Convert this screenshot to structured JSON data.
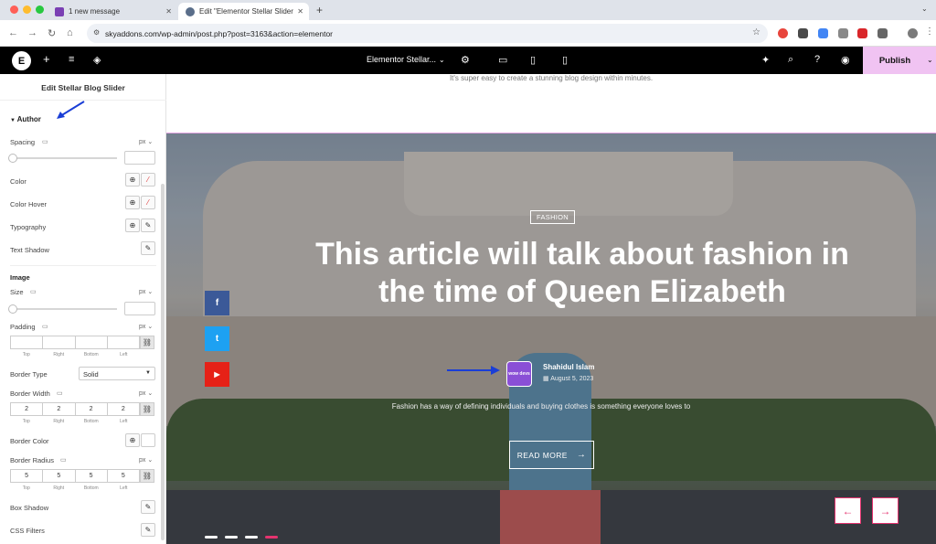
{
  "browser": {
    "tabs": [
      {
        "label": "1 new message"
      },
      {
        "label": "Edit \"Elementor Stellar Slider"
      }
    ],
    "new_tab": "+",
    "url": "skyaddons.com/wp-admin/post.php?post=3163&action=elementor",
    "url_icon": "site-info-icon",
    "colors": {
      "tabbar": "#dfe3ea",
      "close": "#ff5f57",
      "min": "#febc2e",
      "max": "#28c840"
    }
  },
  "editor_bar": {
    "logo": "E",
    "page_title": "Elementor Stellar...",
    "publish_label": "Publish",
    "publish_color": "#f0c3f2"
  },
  "panel": {
    "title": "Edit Stellar Blog Slider",
    "author_section": "Author",
    "spacing_label": "Spacing",
    "unit_px": "px",
    "color_label": "Color",
    "color_hover_label": "Color Hover",
    "typography_label": "Typography",
    "text_shadow_label": "Text Shadow",
    "image_section": "Image",
    "size_label": "Size",
    "padding_label": "Padding",
    "dim_labels": [
      "Top",
      "Right",
      "Bottom",
      "Left"
    ],
    "border_type_label": "Border Type",
    "border_type_value": "Solid",
    "border_width_label": "Border Width",
    "border_width_values": [
      "2",
      "2",
      "2",
      "2"
    ],
    "border_color_label": "Border Color",
    "border_radius_label": "Border Radius",
    "border_radius_values": [
      "5",
      "5",
      "5",
      "5"
    ],
    "box_shadow_label": "Box Shadow",
    "css_filters_label": "CSS Filters"
  },
  "canvas": {
    "subtext": "It's super easy to create a stunning blog design within minutes.",
    "category": "FASHION",
    "title": "This article will talk about fashion in the time of Queen Elizabeth",
    "author_logo": "wow devs",
    "author_name": "Shahidul Islam",
    "date": "August 5, 2023",
    "excerpt": "Fashion has a way of defining individuals and buying clothes is something everyone loves to",
    "read_more": "READ MORE",
    "social": [
      {
        "name": "facebook",
        "glyph": "f",
        "color": "#3b5998"
      },
      {
        "name": "twitter",
        "glyph": "t",
        "color": "#1da1f2"
      },
      {
        "name": "youtube",
        "glyph": "▶",
        "color": "#e62117"
      }
    ],
    "prev_arrow": "←",
    "next_arrow": "→",
    "accent": "#e5336f"
  }
}
